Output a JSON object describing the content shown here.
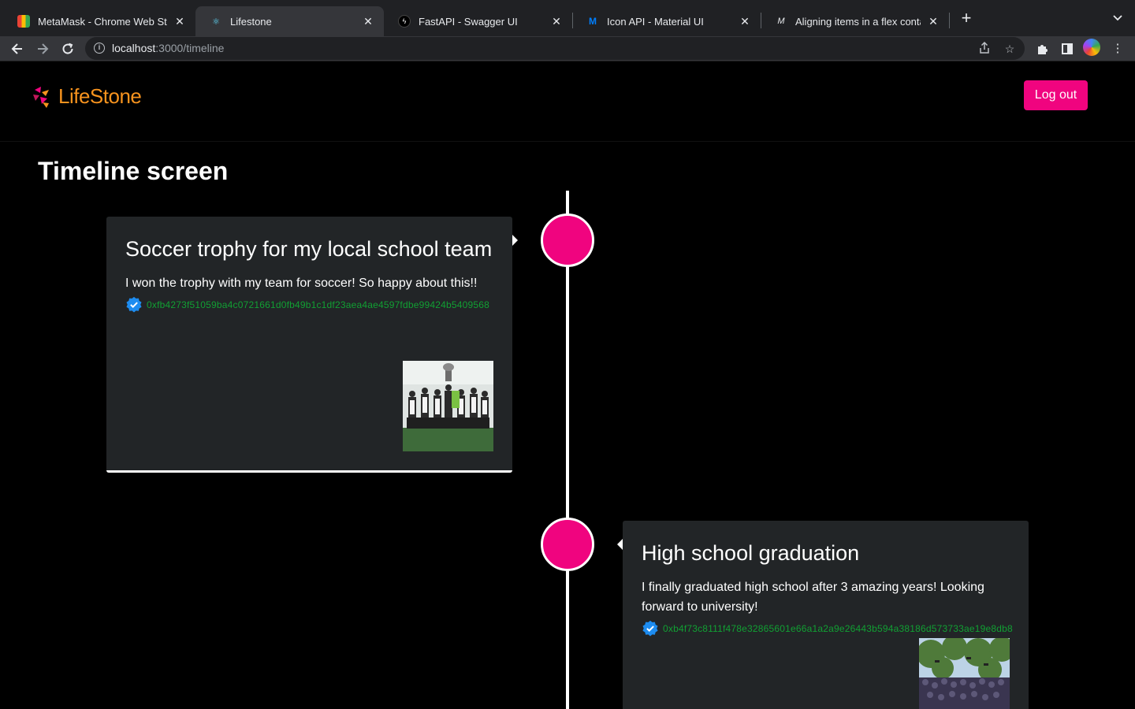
{
  "browser": {
    "tabs": [
      {
        "title": "MetaMask - Chrome Web Store",
        "icon": "chrome-web-store-icon",
        "active": false
      },
      {
        "title": "Lifestone",
        "icon": "react-icon",
        "active": true
      },
      {
        "title": "FastAPI - Swagger UI",
        "icon": "fastapi-icon",
        "active": false
      },
      {
        "title": "Icon API - Material UI",
        "icon": "material-ui-icon",
        "active": false
      },
      {
        "title": "Aligning items in a flex container",
        "icon": "mdn-icon",
        "active": false
      }
    ],
    "close_glyph": "✕",
    "new_tab_glyph": "+",
    "tab_menu_glyph": "⌄",
    "url_host": "localhost",
    "url_path": ":3000/timeline"
  },
  "app": {
    "logo_text": "LifeStone",
    "logout_label": "Log out",
    "page_title": "Timeline screen",
    "brand_color": "#f0047f",
    "logo_color": "#f7931e",
    "hash_color": "#11a033"
  },
  "timeline": {
    "items": [
      {
        "title": "Soccer trophy for my local school team",
        "description": "I won the trophy with my team for soccer! So happy about this!!",
        "hash": "0xfb4273f51059ba4c0721661d0fb49b1c1df23aea4ae4597fdbe99424b5409568",
        "verified_icon": "verified-check-icon",
        "side": "left"
      },
      {
        "title": "High school graduation",
        "description": "I finally graduated high school after 3 amazing years! Looking forward to university!",
        "hash": "0xb4f73c8111f478e32865601e66a1a2a9e26443b594a38186d573733ae19e8db8",
        "verified_icon": "verified-check-icon",
        "side": "right"
      }
    ]
  }
}
